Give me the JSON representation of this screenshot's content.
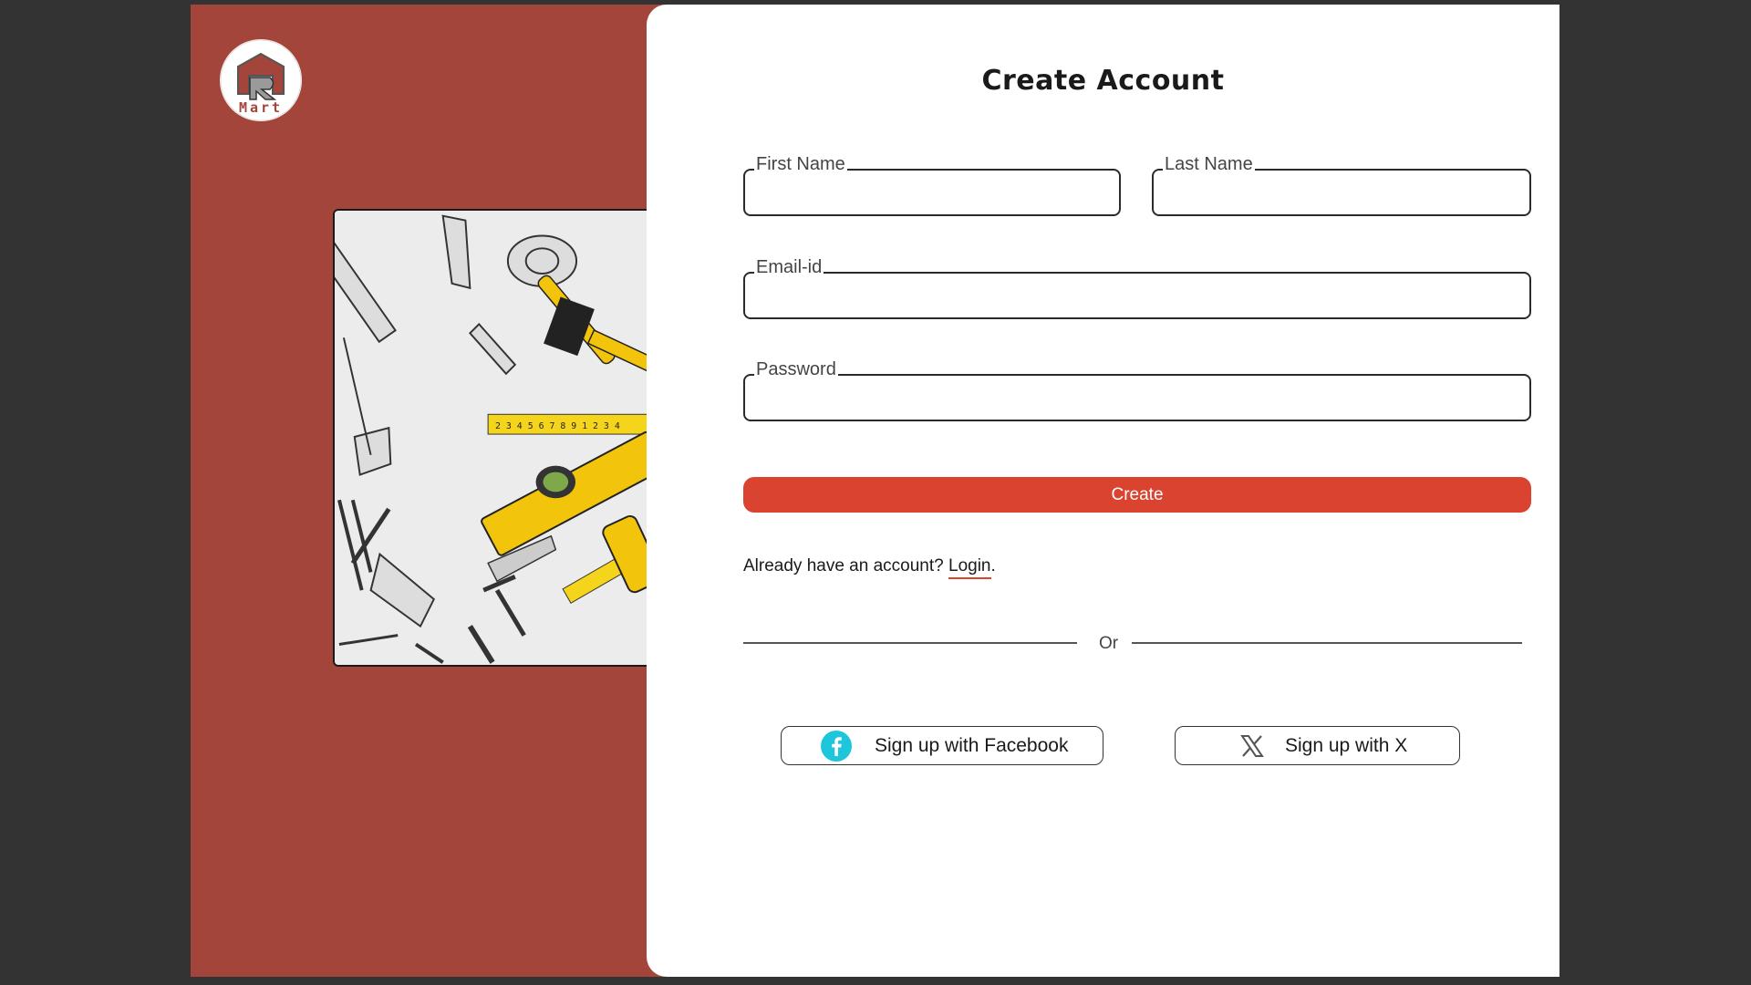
{
  "logo": {
    "text": "Mart",
    "icon": "r-mart-logo"
  },
  "hero_image": {
    "icon": "tools-illustration"
  },
  "form": {
    "title": "Create Account",
    "first_name_label": "First Name",
    "last_name_label": "Last Name",
    "email_label": "Email-id",
    "password_label": "Password",
    "first_name_value": "",
    "last_name_value": "",
    "email_value": "",
    "password_value": "",
    "create_label": "Create",
    "already_text": "Already have an account? ",
    "login_label": "Login",
    "login_suffix": ".",
    "or_text": "Or"
  },
  "social": {
    "facebook_label": "Sign up with Facebook",
    "x_label": "Sign up with X"
  },
  "colors": {
    "panel": "#a3453a",
    "accent": "#da432f",
    "facebook": "#1ec6db",
    "background": "#333333"
  }
}
